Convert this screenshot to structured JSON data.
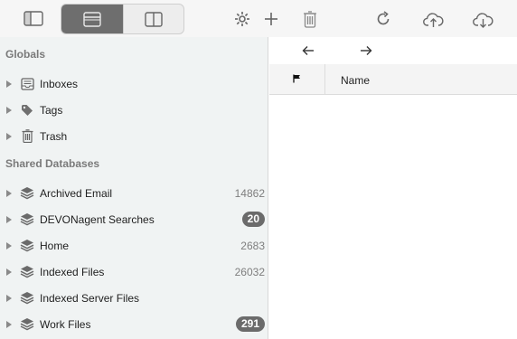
{
  "toolbar": {
    "icons": [
      "sidebar-toggle-icon",
      "view-list-icon",
      "view-split-icon",
      "gear-icon",
      "plus-icon",
      "trash-icon",
      "refresh-icon",
      "upload-icon",
      "download-icon"
    ]
  },
  "sidebar": {
    "globals_title": "Globals",
    "globals": [
      {
        "label": "Inboxes",
        "icon": "inbox-icon"
      },
      {
        "label": "Tags",
        "icon": "tag-icon"
      },
      {
        "label": "Trash",
        "icon": "trash-icon"
      }
    ],
    "shared_title": "Shared Databases",
    "databases": [
      {
        "label": "Archived Email",
        "count": "14862",
        "badge": false
      },
      {
        "label": "DEVONagent Searches",
        "count": "20",
        "badge": true
      },
      {
        "label": "Home",
        "count": "2683",
        "badge": false
      },
      {
        "label": "Indexed Files",
        "count": "26032",
        "badge": false
      },
      {
        "label": "Indexed Server Files",
        "count": "",
        "badge": false
      },
      {
        "label": "Work Files",
        "count": "291",
        "badge": true
      }
    ]
  },
  "main": {
    "back_icon": "arrow-left-icon",
    "forward_icon": "arrow-right-icon",
    "columns": {
      "flag_icon": "flag-icon",
      "name": "Name"
    }
  },
  "colors": {
    "sidebar_bg": "#f0f3f3",
    "badge_bg": "#6b6b6b",
    "segment_active": "#6e6e6e"
  }
}
